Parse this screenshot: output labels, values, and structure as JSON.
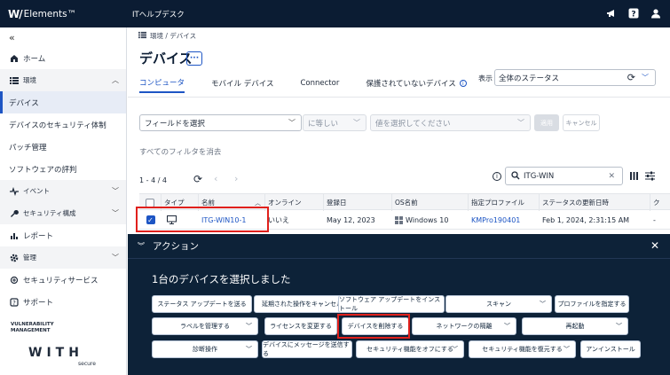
{
  "app": {
    "logo_mark": "W/",
    "logo_text": "Elements™",
    "header_title": "ITヘルプデスク"
  },
  "sidebar": {
    "collapse": "«",
    "items": [
      {
        "label": "ホーム"
      },
      {
        "label": "環境"
      },
      {
        "label": "デバイス"
      },
      {
        "label": "デバイスのセキュリティ体制"
      },
      {
        "label": "パッチ管理"
      },
      {
        "label": "ソフトウェアの評判"
      },
      {
        "label": "イベント"
      },
      {
        "label": "セキュリティ構成"
      },
      {
        "label": "レポート"
      },
      {
        "label": "管理"
      },
      {
        "label": "セキュリティサービス"
      },
      {
        "label": "サポート"
      }
    ],
    "brand": {
      "vm_line1": "VULNERABILITY",
      "vm_line2": "MANAGEMENT",
      "with": "WITH",
      "secure": "secure"
    }
  },
  "main": {
    "breadcrumb": "環境 / デバイス",
    "page_title": "デバイス",
    "more_label": "···",
    "tabs": [
      {
        "label": "コンピュータ"
      },
      {
        "label": "モバイル デバイス"
      },
      {
        "label": "Connector"
      },
      {
        "label": "保護されていないデバイス"
      }
    ],
    "view_label": "表示",
    "view_value": "全体のステータス",
    "filter": {
      "field_placeholder": "フィールドを選択",
      "operator": "に等しい",
      "value_placeholder": "値を選択してください",
      "apply": "適用",
      "cancel": "キャンセル",
      "clear_all": "すべてのフィルタを消去"
    },
    "table": {
      "row_count": "1 - 4 / 4",
      "search_value": "ITG-WIN",
      "columns": [
        "タイプ",
        "名前",
        "オンライン",
        "登録日",
        "OS名前",
        "指定プロファイル",
        "ステータスの更新日時",
        "ク"
      ],
      "rows": [
        {
          "name": "ITG-WIN10-1",
          "online": "いいえ",
          "registered": "May 12, 2023",
          "os": "Windows 10",
          "profile": "KMPro190401",
          "status_updated": "Feb 1, 2024, 2:31:15 AM",
          "extra": "-"
        }
      ]
    }
  },
  "action_panel": {
    "title": "アクション",
    "close": "✕",
    "selection_text": "1台のデバイスを選択しました",
    "buttons": {
      "b1": "ステータス アップデートを送る",
      "b2": "延期された操作をキャンセルする",
      "b3": "ソフトウェア アップデートをインストール",
      "b4": "スキャン",
      "b5": "プロファイルを指定する",
      "b6": "ラベルを管理する",
      "b7": "ライセンスを変更する",
      "b8": "デバイスを削除する",
      "b9": "ネットワークの隔離",
      "b10": "再起動",
      "b11": "診断操作",
      "b12": "デバイスにメッセージを送信する",
      "b13": "セキュリティ機能をオフにする",
      "b14": "セキュリティ機能を復元する",
      "b15": "アンインストール"
    }
  }
}
